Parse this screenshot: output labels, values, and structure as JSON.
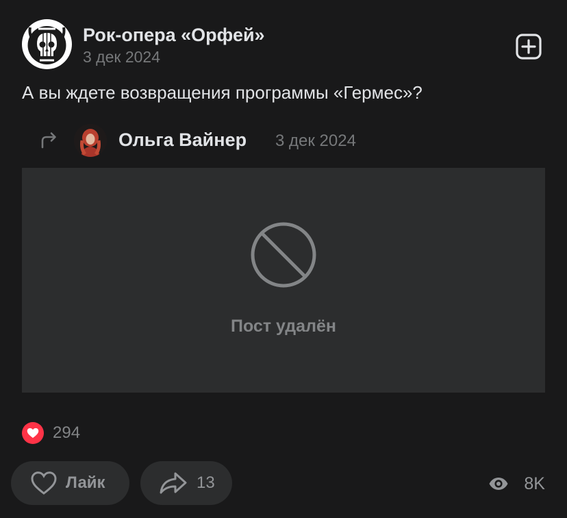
{
  "post": {
    "author": "Рок-опера «Орфей»",
    "date": "3 дек 2024",
    "text": "А вы ждете возвращения программы «Гермес»?"
  },
  "repost": {
    "author": "Ольга Вайнер",
    "date": "3 дек 2024",
    "deleted_label": "Пост удалён"
  },
  "reactions": {
    "count": "294"
  },
  "actions": {
    "like_label": "Лайк",
    "share_count": "13",
    "views": "8K"
  },
  "icons": {
    "add": "plus-square-icon",
    "repost": "repost-arrow-icon",
    "deleted": "prohibited-icon",
    "reaction": "heart-icon",
    "like": "heart-outline-icon",
    "share": "share-arrow-icon",
    "views": "eye-icon"
  },
  "colors": {
    "background": "#19191a",
    "card": "#2c2d2e",
    "text_primary": "#e1e3e6",
    "text_secondary": "#76787a",
    "reaction": "#ff3347"
  }
}
